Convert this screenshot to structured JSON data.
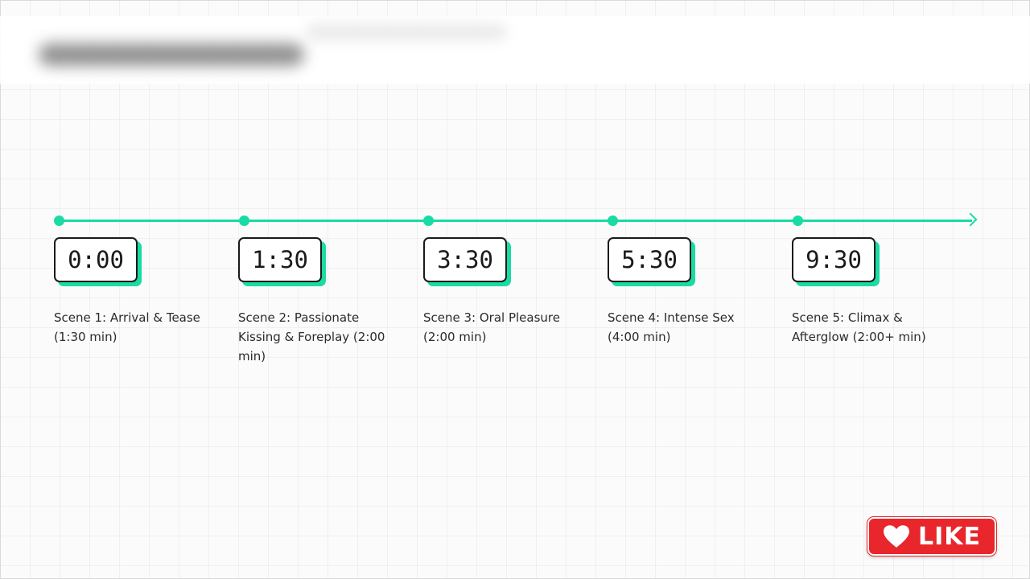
{
  "timeline": {
    "milestones": [
      {
        "time": "0:00",
        "label": "Scene 1: Arrival & Tease (1:30 min)"
      },
      {
        "time": "1:30",
        "label": "Scene 2: Passionate Kissing & Foreplay (2:00 min)"
      },
      {
        "time": "3:30",
        "label": "Scene 3: Oral Pleasure (2:00 min)"
      },
      {
        "time": "5:30",
        "label": "Scene 4: Intense Sex (4:00 min)"
      },
      {
        "time": "9:30",
        "label": "Scene 5: Climax & Afterglow (2:00+ min)"
      }
    ]
  },
  "like_button": {
    "label": "LIKE",
    "icon": "heart-icon"
  },
  "colors": {
    "accent": "#19dba3",
    "box_border": "#1a1a1a",
    "like_bg": "#e8262b"
  }
}
